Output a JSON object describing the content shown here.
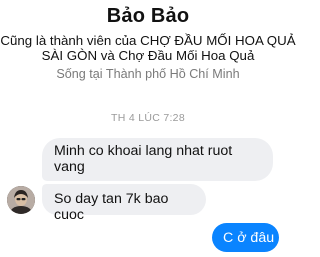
{
  "profile": {
    "name": "Bảo Bảo",
    "mutual_groups_line1": "Cũng là thành viên của CHỢ ĐẦU MỐI HOA QUẢ",
    "mutual_groups_line2": "SÀI GÒN và Chợ Đầu Mối Hoa Quả",
    "location": "Sống tại Thành phố Hồ Chí Minh"
  },
  "conversation": {
    "timestamp": "TH 4 LÚC 7:28",
    "messages": [
      {
        "sender": "contact",
        "text": "Minh co khoai lang nhat ruot vang"
      },
      {
        "sender": "contact",
        "text": "So day tan 7k bao cuoc"
      },
      {
        "sender": "me",
        "text": "C ở đâu"
      }
    ]
  },
  "colors": {
    "outgoing_bubble": "#0a84ff",
    "incoming_bubble": "#eeeff2"
  }
}
